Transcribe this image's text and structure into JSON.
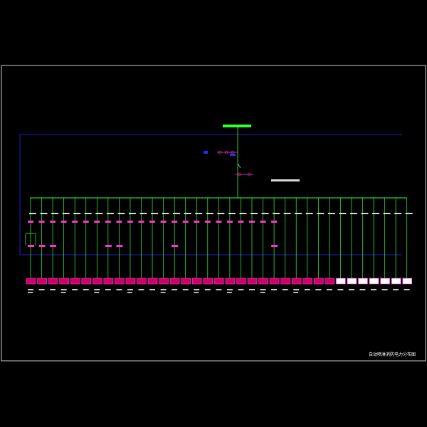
{
  "drawing": {
    "title": "自动喷淋消防电力分布图",
    "top_label": "",
    "left_label": "",
    "right_label": ""
  },
  "colors": {
    "background": "#000000",
    "frame": "#ffffff",
    "blue_bus": "#2a2aff",
    "green_feeder": "#33ff33",
    "magenta_device": "#ff33cc",
    "white_text": "#ffffff"
  },
  "feeders": {
    "count": 35,
    "with_switch_count": 23,
    "with_extra_box": [
      0,
      1,
      2,
      7,
      8,
      13,
      22
    ]
  }
}
